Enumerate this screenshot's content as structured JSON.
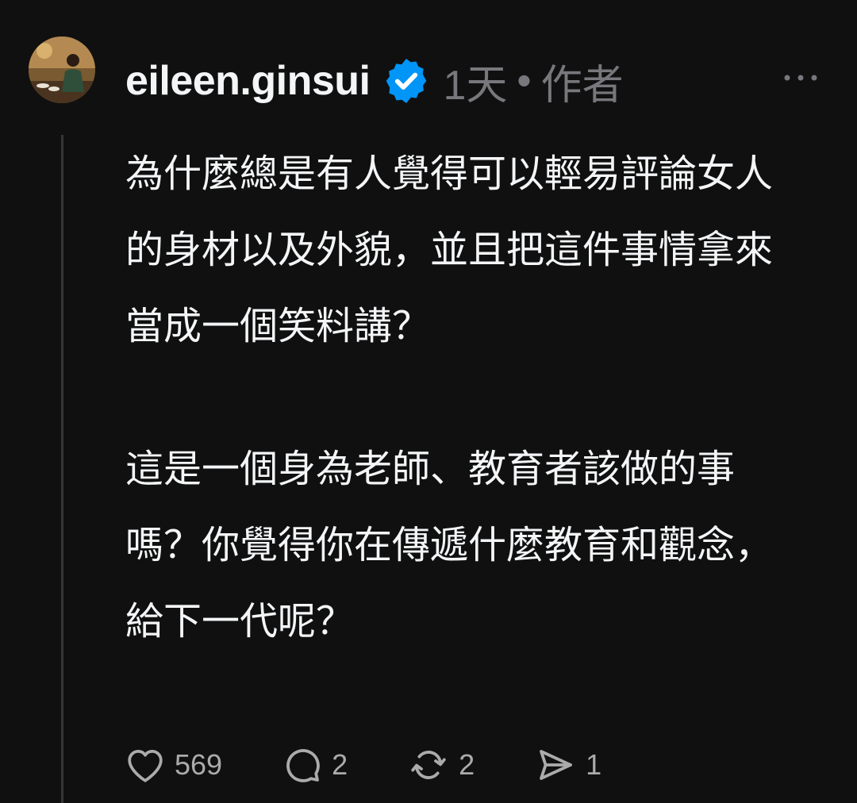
{
  "post": {
    "author": {
      "username": "eileen.ginsui",
      "verified": true,
      "avatar": "avatar-photo"
    },
    "time": "1天",
    "separator": "•",
    "role": "作者",
    "paragraphs": [
      "為什麼總是有人覺得可以輕易評論女人的身材以及外貌，並且把這件事情拿來當成一個笑料講？",
      "這是一個身為老師、教育者該做的事嗎？你覺得你在傳遞什麼教育和觀念，給下一代呢？"
    ],
    "actions": {
      "likes": "569",
      "replies": "2",
      "reposts": "2",
      "shares": "1"
    }
  },
  "colors": {
    "background": "#101010",
    "text": "#f3f5f7",
    "muted": "#77777c",
    "verified_badge": "#0095f6",
    "thread_line": "#333638"
  },
  "icons": {
    "more": "more-horizontal-icon",
    "verified": "verified-badge-icon",
    "like": "heart-icon",
    "reply": "comment-icon",
    "repost": "repost-icon",
    "share": "send-icon"
  }
}
